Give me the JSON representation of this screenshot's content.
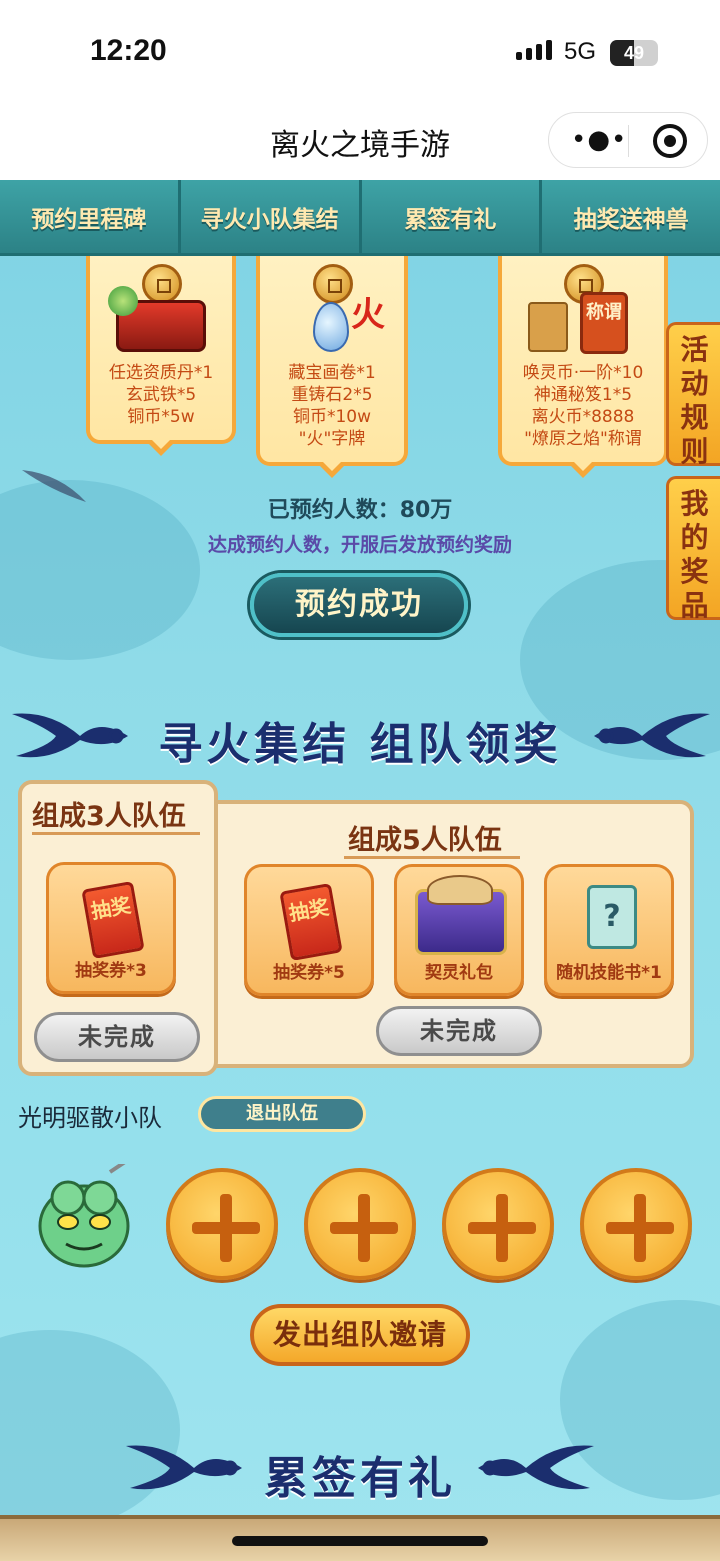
{
  "status": {
    "time": "12:20",
    "network": "5G",
    "battery": "49",
    "battery_level_percent": 49
  },
  "titlebar": {
    "title": "离火之境手游",
    "more_icon": "more-dots-icon",
    "close_icon": "target-circle-icon"
  },
  "tabs": [
    "预约里程碑",
    "寻火小队集结",
    "累签有礼",
    "抽奖送神兽"
  ],
  "milestones": [
    {
      "lines": [
        "任选资质丹*1",
        "玄武铁*5",
        "铜币*5w"
      ]
    },
    {
      "lines": [
        "藏宝画卷*1",
        "重铸石2*5",
        "铜币*10w",
        "\"火\"字牌"
      ],
      "badge": "火"
    },
    {
      "lines": [
        "唤灵币·一阶*10",
        "神通秘笈1*5",
        "离火币*8888",
        "\"燎原之焰\"称谓"
      ],
      "badge": "称谓"
    }
  ],
  "side_buttons": {
    "rules": "活动规则",
    "prizes": "我的奖品"
  },
  "reservation": {
    "count_text": "已预约人数：80万",
    "hint": "达成预约人数，开服后发放预约奖励",
    "button": "预约成功"
  },
  "team_section": {
    "title": "寻火集结 组队领奖",
    "team3": {
      "title": "组成3人队伍",
      "rewards": [
        {
          "label": "抽奖券*3",
          "ticket": "抽奖"
        }
      ],
      "status": "未完成"
    },
    "team5": {
      "title": "组成5人队伍",
      "rewards": [
        {
          "label": "抽奖券*5",
          "ticket": "抽奖"
        },
        {
          "label": "契灵礼包"
        },
        {
          "label": "随机技能书*1",
          "mark": "?"
        }
      ],
      "status": "未完成"
    },
    "team_name": "光明驱散小队",
    "quit_button": "退出队伍",
    "invite_button": "发出组队邀请"
  },
  "sign_section": {
    "title": "累签有礼"
  },
  "colors": {
    "tab_bg": "#2f8a8f",
    "page_bg": "#8fdbe8",
    "accent_orange": "#f3a524",
    "title_navy": "#1b2e6e"
  }
}
